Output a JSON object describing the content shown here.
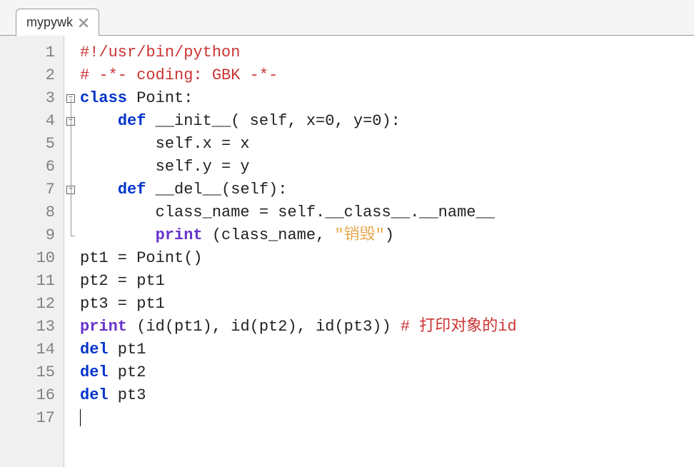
{
  "tab": {
    "label": "mypywk"
  },
  "lines": {
    "l1": {
      "num": "1",
      "fold": "",
      "tokens": [
        {
          "c": "tk-comment",
          "t": "#!/usr/bin/python"
        }
      ]
    },
    "l2": {
      "num": "2",
      "fold": "",
      "tokens": [
        {
          "c": "tk-comment",
          "t": "# -*- coding: GBK -*-"
        }
      ]
    },
    "l3": {
      "num": "3",
      "fold": "box",
      "tokens": [
        {
          "c": "tk-keyword",
          "t": "class"
        },
        {
          "c": "tk-default",
          "t": " Point:"
        }
      ]
    },
    "l4": {
      "num": "4",
      "fold": "box-v",
      "tokens": [
        {
          "c": "tk-default",
          "t": "    "
        },
        {
          "c": "tk-keyword",
          "t": "def"
        },
        {
          "c": "tk-default",
          "t": " __init__( self, x=0, y=0):"
        }
      ]
    },
    "l5": {
      "num": "5",
      "fold": "v",
      "tokens": [
        {
          "c": "tk-default",
          "t": "        self.x = x"
        }
      ]
    },
    "l6": {
      "num": "6",
      "fold": "v",
      "tokens": [
        {
          "c": "tk-default",
          "t": "        self.y = y"
        }
      ]
    },
    "l7": {
      "num": "7",
      "fold": "box-v",
      "tokens": [
        {
          "c": "tk-default",
          "t": "    "
        },
        {
          "c": "tk-keyword",
          "t": "def"
        },
        {
          "c": "tk-default",
          "t": " __del__(self):"
        }
      ]
    },
    "l8": {
      "num": "8",
      "fold": "v",
      "tokens": [
        {
          "c": "tk-default",
          "t": "        class_name = self.__class__.__name__"
        }
      ]
    },
    "l9": {
      "num": "9",
      "fold": "end",
      "tokens": [
        {
          "c": "tk-default",
          "t": "        "
        },
        {
          "c": "tk-builtin",
          "t": "print"
        },
        {
          "c": "tk-default",
          "t": " (class_name, "
        },
        {
          "c": "tk-string",
          "t": "\"销毁\""
        },
        {
          "c": "tk-default",
          "t": ")"
        }
      ]
    },
    "l10": {
      "num": "10",
      "fold": "",
      "tokens": [
        {
          "c": "tk-default",
          "t": "pt1 = Point()"
        }
      ]
    },
    "l11": {
      "num": "11",
      "fold": "",
      "tokens": [
        {
          "c": "tk-default",
          "t": "pt2 = pt1"
        }
      ]
    },
    "l12": {
      "num": "12",
      "fold": "",
      "tokens": [
        {
          "c": "tk-default",
          "t": "pt3 = pt1"
        }
      ]
    },
    "l13": {
      "num": "13",
      "fold": "",
      "tokens": [
        {
          "c": "tk-builtin",
          "t": "print"
        },
        {
          "c": "tk-default",
          "t": " (id(pt1), id(pt2), id(pt3)) "
        },
        {
          "c": "tk-comment",
          "t": "# 打印对象的id"
        }
      ]
    },
    "l14": {
      "num": "14",
      "fold": "",
      "tokens": [
        {
          "c": "tk-keyword",
          "t": "del"
        },
        {
          "c": "tk-default",
          "t": " pt1"
        }
      ]
    },
    "l15": {
      "num": "15",
      "fold": "",
      "tokens": [
        {
          "c": "tk-keyword",
          "t": "del"
        },
        {
          "c": "tk-default",
          "t": " pt2"
        }
      ]
    },
    "l16": {
      "num": "16",
      "fold": "",
      "tokens": [
        {
          "c": "tk-keyword",
          "t": "del"
        },
        {
          "c": "tk-default",
          "t": " pt3"
        }
      ]
    },
    "l17": {
      "num": "17",
      "fold": "",
      "tokens": [
        {
          "c": "tk-default",
          "t": ""
        }
      ]
    }
  },
  "lineOrder": [
    "l1",
    "l2",
    "l3",
    "l4",
    "l5",
    "l6",
    "l7",
    "l8",
    "l9",
    "l10",
    "l11",
    "l12",
    "l13",
    "l14",
    "l15",
    "l16",
    "l17"
  ]
}
